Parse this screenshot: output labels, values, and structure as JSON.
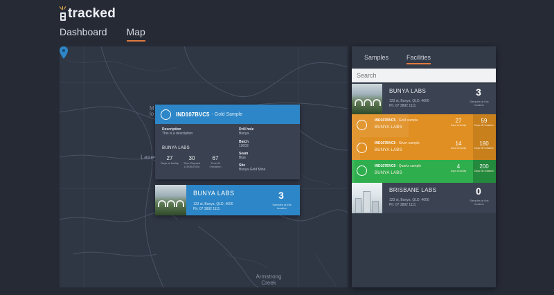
{
  "app": {
    "title": "tracked"
  },
  "nav": {
    "items": [
      {
        "label": "Dashboard"
      },
      {
        "label": "Map"
      }
    ]
  },
  "map": {
    "labels": {
      "m1": "M",
      "m2": "lo",
      "laxey": "Laxey",
      "armstrong_creek": "Armstrong Creek"
    },
    "popup": {
      "sample_id": "IND107BVC5",
      "sample_type": "- Gold Sample",
      "description_label": "Description",
      "description_value": "This is a description",
      "drillhole_label": "Drill hole",
      "drillhole_value": "Bunya",
      "batch_label": "Batch",
      "batch_value": "10002",
      "seam_label": "Seam",
      "seam_value": "Blue",
      "site_label": "Site",
      "site_value": "Bunya Gold Mine",
      "lab": "BUNYA LABS",
      "stats": [
        {
          "value": "27",
          "label": "Days at facility"
        },
        {
          "value": "30",
          "label": "Time Elapsed (13/08/2015)"
        },
        {
          "value": "67",
          "label": "Time till Oxidation"
        }
      ]
    },
    "facility_card": {
      "name": "BUNYA LABS",
      "address": "123 st, Bunya, QLD, 4000",
      "phone": "Ph: 07 3892 1111",
      "count": "3",
      "count_label": "Samples at this location"
    }
  },
  "sidebar": {
    "tabs": [
      {
        "label": "Samples"
      },
      {
        "label": "Facilities"
      }
    ],
    "search_placeholder": "Search",
    "facilities": [
      {
        "name": "BUNYA LABS",
        "address": "123 st, Bunya, QLD, 4000",
        "phone": "Ph: 07 3892 1111",
        "count": "3",
        "count_label": "Samples at this location",
        "samples": [
          {
            "id": "IND107BVC5",
            "type": "- Gold sample",
            "lab": "BUNYA LABS",
            "days": "27",
            "days_label": "Days at facility",
            "oxidation": "59",
            "oxidation_label": "Days till Oxidation",
            "color": "#e08f22",
            "right_color": "#c8801c",
            "progress": 0.47
          },
          {
            "id": "IND107BVC5",
            "type": "- Silver sample",
            "lab": "BUNYA LABS",
            "days": "14",
            "days_label": "Days at facility",
            "oxidation": "180",
            "oxidation_label": "Days till Oxidation",
            "color": "#e08f22",
            "right_color": "#c8801c",
            "progress": 0.07
          },
          {
            "id": "IND107BVC5",
            "type": "- Quartz sample",
            "lab": "BUNYA LABS",
            "days": "4",
            "days_label": "Days at facility",
            "oxidation": "200",
            "oxidation_label": "Days till Oxidation",
            "color": "#2fae4e",
            "right_color": "#23893c",
            "progress": 0.02
          }
        ]
      },
      {
        "name": "BRISBANE LABS",
        "address": "123 st, Bunya, QLD, 4000",
        "phone": "Ph: 07 3892 1111",
        "count": "0",
        "count_label": "Samples at this location"
      }
    ]
  },
  "colors": {
    "accent": "#e07a3e",
    "primary": "#2d86c7",
    "warning": "#e08f22",
    "success": "#2fae4e"
  }
}
